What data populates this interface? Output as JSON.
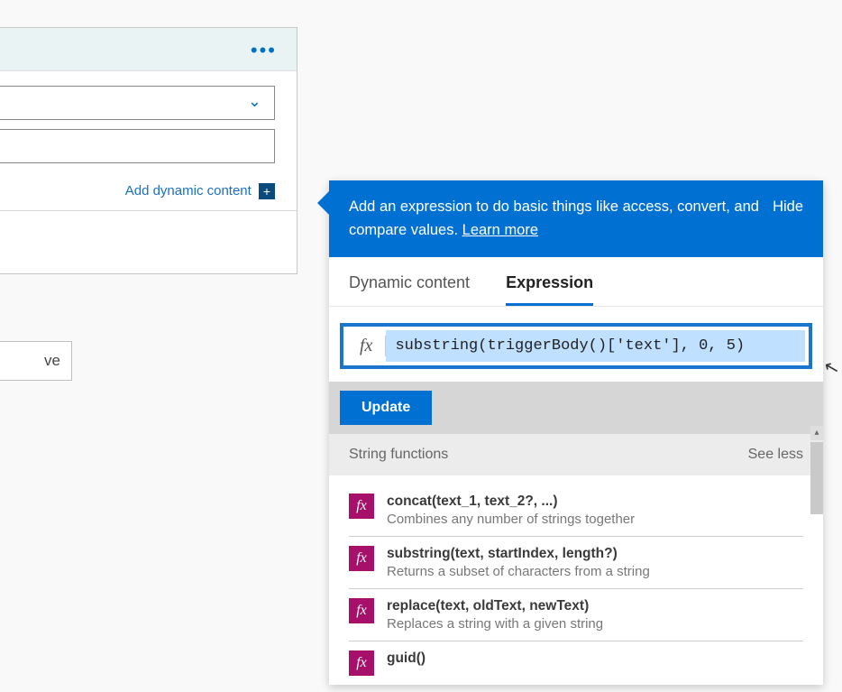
{
  "card": {
    "more": "•••",
    "chevron": "⌄",
    "dropdown_value": "",
    "text_value": "",
    "add_dynamic_label": "Add dynamic content",
    "plus_glyph": "+"
  },
  "save_button": {
    "label": "ve"
  },
  "flyout": {
    "intro_line": "Add an expression to do basic things like access, convert, and compare values. ",
    "learn_more": "Learn more",
    "hide": "Hide",
    "tabs": {
      "dynamic": "Dynamic content",
      "expression": "Expression",
      "active": "expression"
    },
    "fx": "fx",
    "expression_value": "substring(triggerBody()['text'], 0, 5)",
    "update": "Update",
    "section_title": "String functions",
    "see_less": "See less",
    "fn_icon": "fx",
    "functions": [
      {
        "sig": "concat(text_1, text_2?, ...)",
        "desc": "Combines any number of strings together"
      },
      {
        "sig": "substring(text, startIndex, length?)",
        "desc": "Returns a subset of characters from a string"
      },
      {
        "sig": "replace(text, oldText, newText)",
        "desc": "Replaces a string with a given string"
      },
      {
        "sig": "guid()",
        "desc": ""
      }
    ]
  },
  "scroll_arrow_glyph": "▴"
}
